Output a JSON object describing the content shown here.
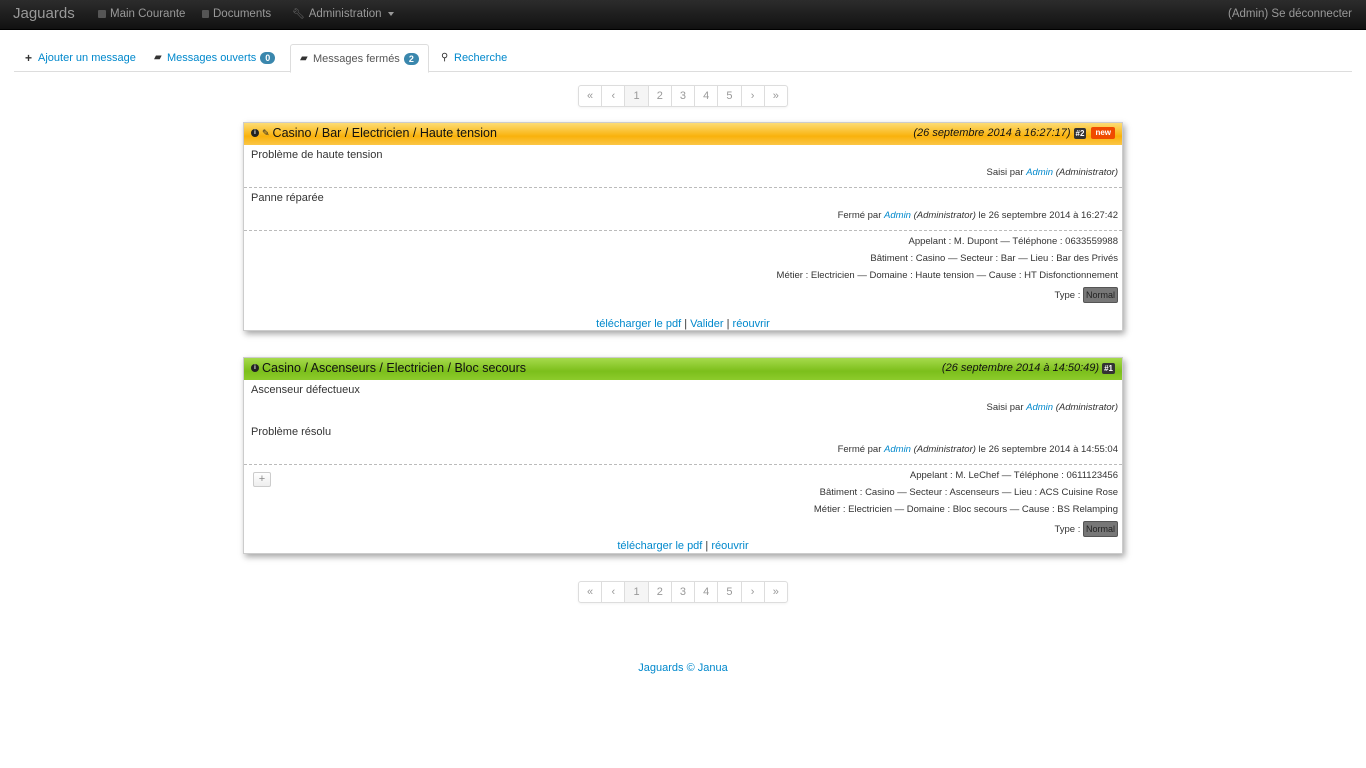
{
  "navbar": {
    "brand": "Jaguards",
    "items": [
      "Main Courante",
      "Documents",
      "Administration"
    ],
    "logout": "(Admin) Se déconnecter"
  },
  "tabs": [
    {
      "label": "Ajouter un message",
      "icon": "plus-icon"
    },
    {
      "label": "Messages ouverts",
      "icon": "folder-open-icon",
      "count": "0"
    },
    {
      "label": "Messages fermés",
      "icon": "folder-icon",
      "count": "2"
    },
    {
      "label": "Recherche",
      "icon": "search-icon"
    }
  ],
  "pagination": {
    "first": "«",
    "prev": "‹",
    "pages": [
      "1",
      "2",
      "3",
      "4",
      "5"
    ],
    "next": "›",
    "last": "»",
    "active": "1"
  },
  "messages": [
    {
      "title": "Casino / Bar / Electricien / Haute tension",
      "date": "(26 septembre 2014 à 16:27:17)",
      "id": "#2",
      "new": "new",
      "header_color": "#f9b20c",
      "description": "Problème de haute tension",
      "saisi_prefix": "Saisi par",
      "saisi_user": "Admin",
      "saisi_role": "(Administrator)",
      "resolution": "Panne réparée",
      "ferme_prefix": "Fermé par",
      "ferme_user": "Admin",
      "ferme_role": "(Administrator)",
      "ferme_date": "le 26 septembre 2014 à 16:27:42",
      "appelant": "Appelant : M. Dupont — Téléphone : 0633559988",
      "batiment": "Bâtiment : Casino — Secteur : Bar — Lieu : Bar des Privés",
      "metier": "Métier : Electricien — Domaine : Haute tension — Cause : HT Disfonctionnement",
      "type_label": "Type :",
      "type_value": "Normal",
      "actions": [
        "télécharger le pdf",
        "Valider",
        "réouvrir"
      ]
    },
    {
      "title": "Casino / Ascenseurs / Electricien / Bloc secours",
      "date": "(26 septembre 2014 à 14:50:49)",
      "id": "#1",
      "header_color": "#7cbf1b",
      "description": "Ascenseur défectueux",
      "saisi_prefix": "Saisi par",
      "saisi_user": "Admin",
      "saisi_role": "(Administrator)",
      "resolution": "Problème résolu",
      "ferme_prefix": "Fermé par",
      "ferme_user": "Admin",
      "ferme_role": "(Administrator)",
      "ferme_date": "le 26 septembre 2014 à 14:55:04",
      "expand_label": "+",
      "appelant": "Appelant : M. LeChef — Téléphone : 0611123456",
      "batiment": "Bâtiment : Casino — Secteur : Ascenseurs — Lieu : ACS Cuisine Rose",
      "metier": "Métier : Electricien — Domaine : Bloc secours — Cause : BS Relamping",
      "type_label": "Type :",
      "type_value": "Normal",
      "actions": [
        "télécharger le pdf",
        "réouvrir"
      ]
    }
  ],
  "footer": "Jaguards © Janua"
}
